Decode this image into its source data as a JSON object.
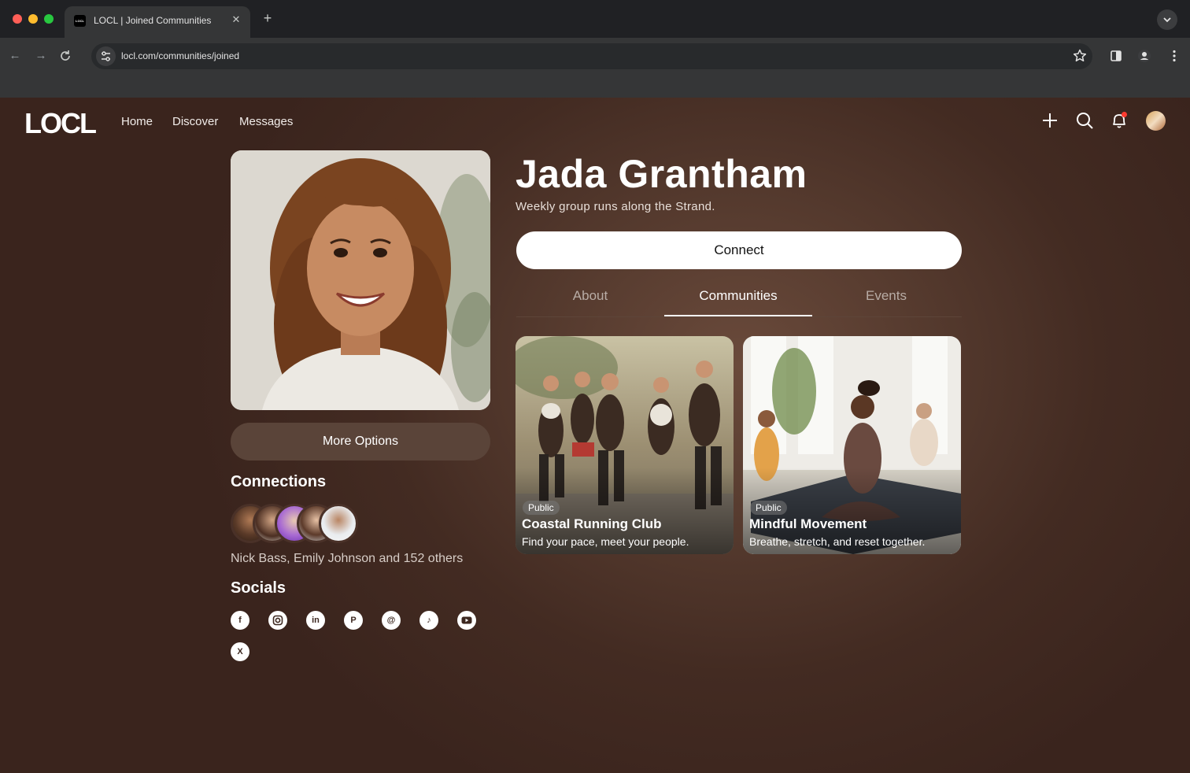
{
  "browser": {
    "tab_title": "LOCL | Joined Communities",
    "favicon_text": "LOCL",
    "url": "locl.com/communities/joined"
  },
  "nav": {
    "logo": "LOCL",
    "links": [
      "Home",
      "Discover",
      "Messages"
    ],
    "icons": [
      "plus-icon",
      "search-icon",
      "bell-icon",
      "avatar"
    ],
    "notification_dot_color": "#ff3b30"
  },
  "profile": {
    "name": "Jada Grantham",
    "tagline": "Weekly group runs along the Strand.",
    "connect_label": "Connect",
    "more_options_label": "More Options"
  },
  "tabs": {
    "items": [
      "About",
      "Communities",
      "Events"
    ],
    "active": "Communities"
  },
  "communities": [
    {
      "badge": "Public",
      "title": "Coastal Running Club",
      "description": "Find your pace, meet your people."
    },
    {
      "badge": "Public",
      "title": "Mindful Movement",
      "description": "Breathe, stretch, and reset together."
    }
  ],
  "connections": {
    "heading": "Connections",
    "summary": "Nick Bass, Emily Johnson and 152 others"
  },
  "socials": {
    "heading": "Socials",
    "icons": [
      "facebook-icon",
      "instagram-icon",
      "linkedin-icon",
      "pinterest-icon",
      "threads-icon",
      "tiktok-icon",
      "youtube-icon",
      "x-icon"
    ]
  },
  "colors": {
    "page_bg": "#432b22",
    "button_dark": "#5a4439",
    "button_light": "#ffffff"
  }
}
